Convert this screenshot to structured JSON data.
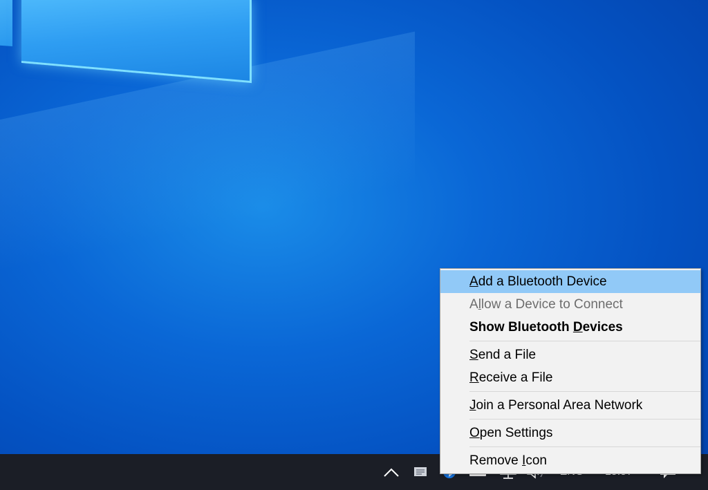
{
  "taskbar": {
    "language": "ENG",
    "clock_time": "15:57",
    "tray_icons": [
      "chevron-up-icon",
      "message-icon",
      "bluetooth-icon",
      "battery-icon",
      "network-icon",
      "volume-icon",
      "action-center-icon"
    ]
  },
  "context_menu": {
    "items": [
      {
        "pre": "",
        "key": "A",
        "post": "dd a Bluetooth Device"
      },
      {
        "pre": "A",
        "key": "l",
        "post": "low a Device to Connect"
      },
      {
        "pre": "Show Bluetooth ",
        "key": "D",
        "post": "evices"
      },
      {
        "pre": "",
        "key": "S",
        "post": "end a File"
      },
      {
        "pre": "",
        "key": "R",
        "post": "eceive a File"
      },
      {
        "pre": "",
        "key": "J",
        "post": "oin a Personal Area Network"
      },
      {
        "pre": "",
        "key": "O",
        "post": "pen Settings"
      },
      {
        "pre": "Remove ",
        "key": "I",
        "post": "con"
      }
    ]
  },
  "colors": {
    "menu_background": "#f2f2f2",
    "menu_highlight": "#91c9f7",
    "taskbar": "#1b1e26",
    "desktop": "#0a67d6"
  }
}
